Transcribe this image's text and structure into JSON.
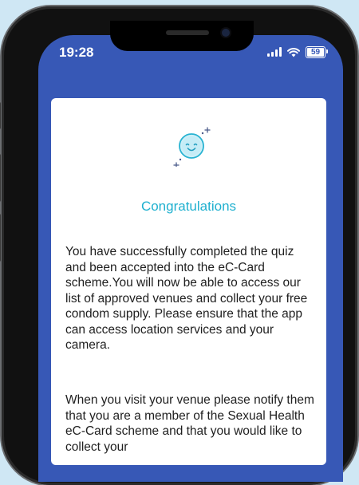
{
  "status_bar": {
    "time": "19:28",
    "battery_level": "59",
    "icons": [
      "signal-icon",
      "wifi-icon",
      "battery-icon"
    ]
  },
  "card": {
    "icon": "smiley-face-icon",
    "title": "Congratulations",
    "paragraph_1": "You have successfully completed the quiz and been accepted into the eC-Card scheme.You will now be able to access our list of approved venues and collect your free condom supply. Please ensure that the app can access location services and your camera.",
    "paragraph_2": "When you visit your venue please notify them that you are a member of the Sexual Health eC-Card scheme and that you would like to collect your"
  },
  "colors": {
    "background": "#cfe7f4",
    "screen": "#3758b6",
    "title": "#1fb0cf",
    "card": "#ffffff"
  }
}
